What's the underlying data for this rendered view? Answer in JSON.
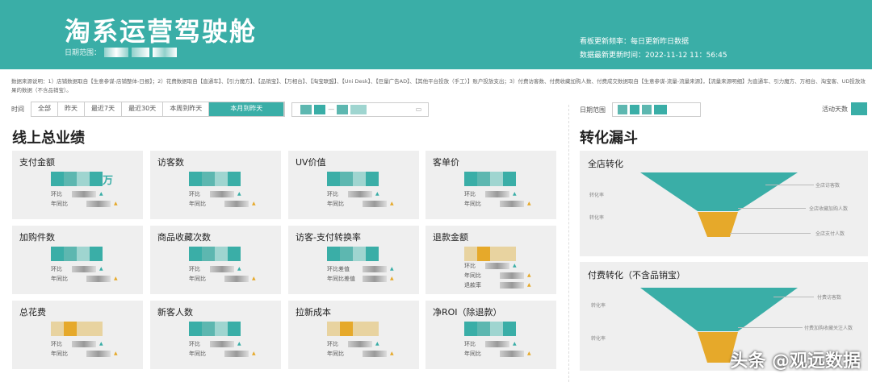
{
  "header": {
    "title": "淘系运营驾驶舱",
    "date_label": "日期范围：",
    "update_freq": "看板更新频率：每日更新昨日数据",
    "update_time": "数据最新更新时间：2022-11-12  11：56:45"
  },
  "source_note": "数据来源说明：1）店铺数据取自【生意参谋-店铺整体-日报】；2）花费数据取自【直通车】、【引力魔方】、【品销宝】、【万相台】、【淘宝联盟】、【Uni Desk】、【巨量广告AD】、【其他平台投放（手工）】账户投放支出；3）付费访客数、付费收藏加购人数、付费成交数据取自【生意参谋-流量-流量来源】，【流量来源明细】为直通车、引力魔方、万相台、淘宝客、UD投放效果的数据（不含品销宝）。",
  "filter": {
    "label": "时间",
    "options": [
      "全部",
      "昨天",
      "最近7天",
      "最近30天",
      "本周到昨天",
      "本月到昨天"
    ],
    "active": 5,
    "date_sep": "—"
  },
  "right_filter": {
    "date_label": "日期范围",
    "active_days_label": "活动天数"
  },
  "sections": {
    "left": "线上总业绩",
    "right": "转化漏斗"
  },
  "cards": [
    {
      "title": "支付金额",
      "unit": "万",
      "rows": [
        "环比",
        "年同比"
      ]
    },
    {
      "title": "访客数",
      "rows": [
        "环比",
        "年同比"
      ]
    },
    {
      "title": "UV价值",
      "rows": [
        "环比",
        "年同比"
      ]
    },
    {
      "title": "客单价",
      "rows": [
        "环比",
        "年同比"
      ]
    },
    {
      "title": "加购件数",
      "rows": [
        "环比",
        "年同比"
      ]
    },
    {
      "title": "商品收藏次数",
      "rows": [
        "环比",
        "年同比"
      ]
    },
    {
      "title": "访客-支付转换率",
      "rows": [
        "环比差值",
        "年同比差值"
      ]
    },
    {
      "title": "退款金额",
      "rows": [
        "环比",
        "年同比",
        "退款率"
      ]
    },
    {
      "title": "总花费",
      "rows": [
        "环比",
        "年同比"
      ]
    },
    {
      "title": "新客人数",
      "rows": [
        "环比",
        "年同比"
      ]
    },
    {
      "title": "拉新成本",
      "rows": [
        "环比",
        "年同比"
      ]
    },
    {
      "title": "净ROI（除退款）",
      "rows": [
        "环比",
        "年同比"
      ]
    }
  ],
  "funnels": [
    {
      "title": "全店转化",
      "rate_label": "转化率",
      "stages": [
        "全店访客数",
        "全店收藏加购人数",
        "全店支付人数"
      ]
    },
    {
      "title": "付费转化（不含品销宝）",
      "rate_label": "转化率",
      "stages": [
        "付费访客数",
        "付费加购收藏关注人数"
      ]
    }
  ],
  "watermark": "头条 @观远数据",
  "colors": {
    "teal": "#3aaea7",
    "orange": "#e6a92a"
  }
}
